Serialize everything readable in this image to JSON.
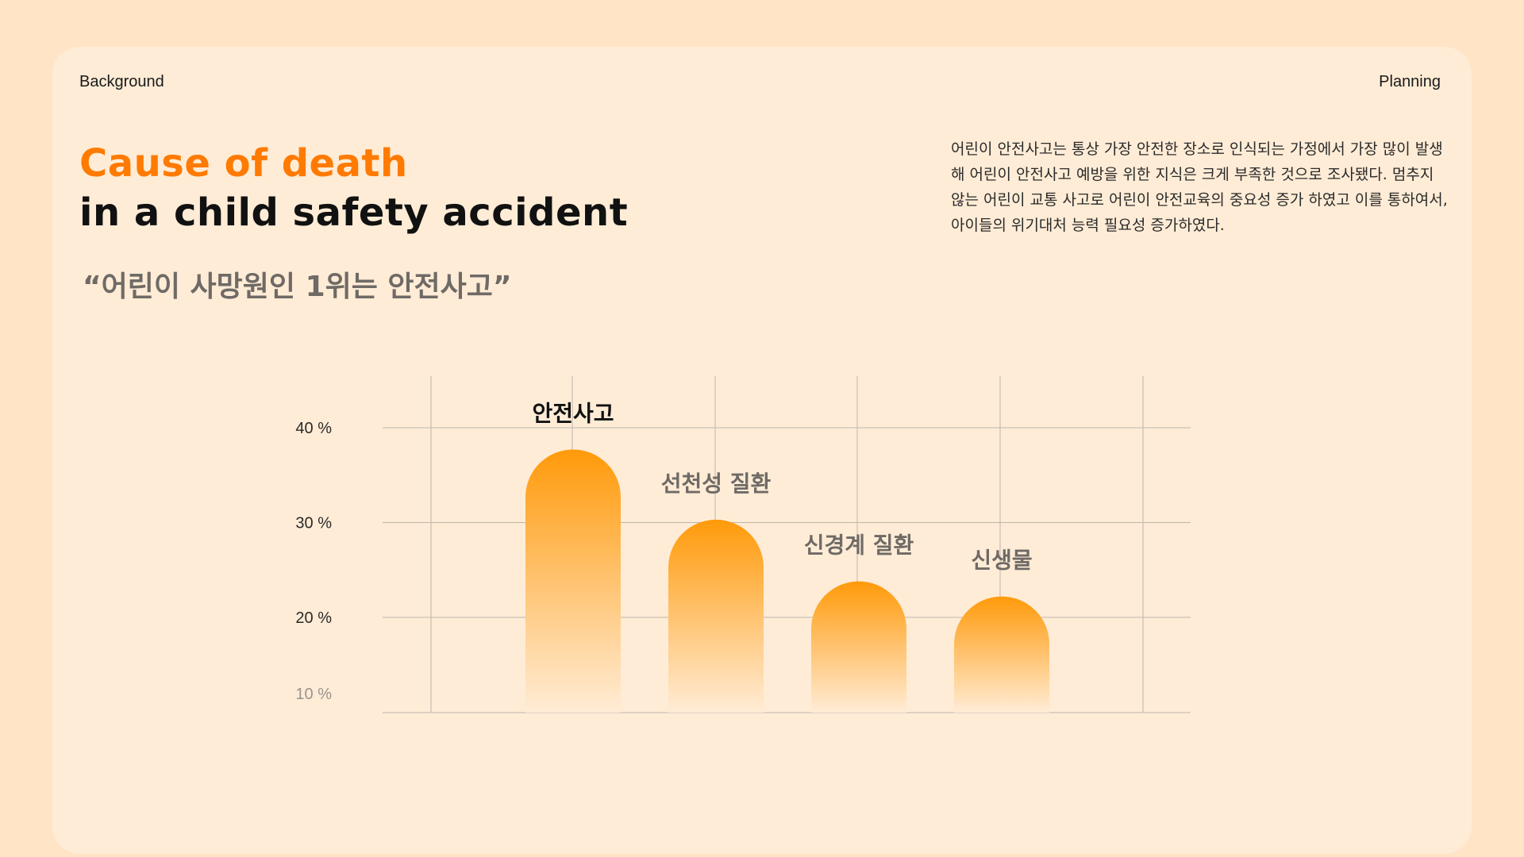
{
  "header": {
    "left_label": "Background",
    "right_label": "Planning"
  },
  "title": {
    "line1": "Cause of death",
    "line2": "in a child safety accident"
  },
  "quote": "“어린이 사망원인 1위는 안전사고”",
  "description": "어린이 안전사고는 통상 가장 안전한 장소로 인식되는 가정에서 가장 많이 발생해 어린이 안전사고 예방을 위한 지식은 크게 부족한 것으로 조사됐다. 멈추지 않는 어린이 교통 사고로 어린이 안전교육의 중요성 증가 하였고 이를 통하여서, 아이들의 위기대처 능력 필요성 증가하였다.",
  "colors": {
    "accent": "#ff7a00",
    "bar_top": "#ff9a0a",
    "bar_bottom": "#ffecd6",
    "grid": "#bdb6ae",
    "background": "#ffe4c6",
    "card": "#ffecd6"
  },
  "chart_data": {
    "type": "bar",
    "categories": [
      "안전사고",
      "선천성 질환",
      "신경계 질환",
      "신생물"
    ],
    "values": [
      37.7,
      30.3,
      23.8,
      22.2
    ],
    "yticks": [
      {
        "value": 40,
        "label": "40 %"
      },
      {
        "value": 30,
        "label": "30 %"
      },
      {
        "value": 20,
        "label": "20 %"
      },
      {
        "value": 10,
        "label": "10 %"
      }
    ],
    "ylim": [
      10,
      40
    ],
    "highlight_index": 0,
    "grid": true
  }
}
